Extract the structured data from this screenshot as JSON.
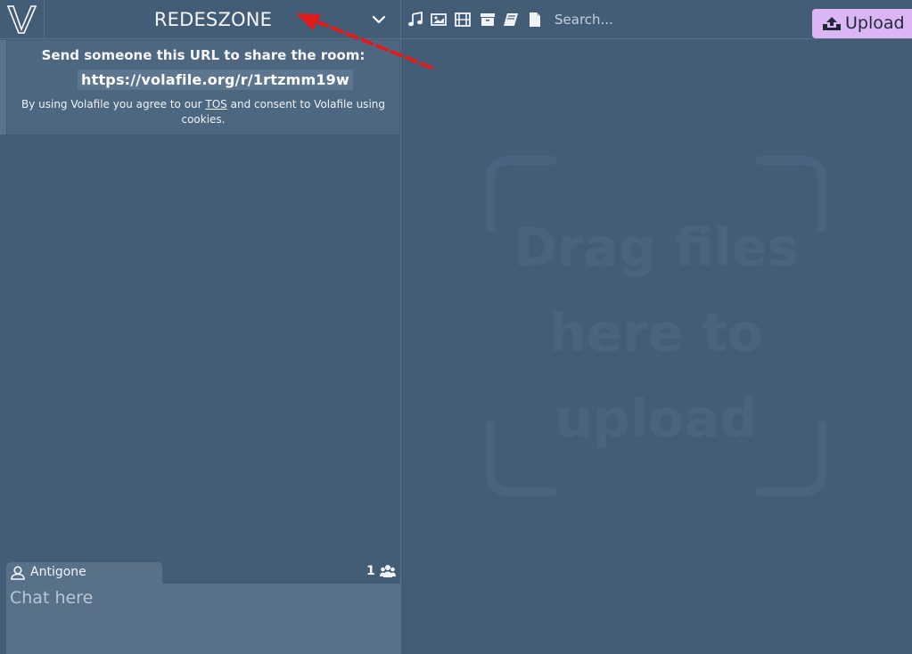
{
  "app": {
    "logo_letter": "V",
    "room_name": "REDESZONE"
  },
  "toolbar": {
    "filters": [
      {
        "name": "audio",
        "icon": "music-note-icon"
      },
      {
        "name": "image",
        "icon": "image-icon"
      },
      {
        "name": "video",
        "icon": "film-icon"
      },
      {
        "name": "archive",
        "icon": "archive-icon"
      },
      {
        "name": "document",
        "icon": "book-icon"
      },
      {
        "name": "other",
        "icon": "file-icon"
      }
    ],
    "search_placeholder": "Search...",
    "upload_label": "Upload",
    "upload_icon": "upload-tray-icon",
    "upload_color": "#dcb5f5"
  },
  "share": {
    "heading": "Send someone this URL to share the room:",
    "url": "https://volafile.org/r/1rtzmm19w",
    "tos_prefix": "By using Volafile you agree to our ",
    "tos_link": "TOS",
    "tos_suffix": " and consent to Volafile using cookies."
  },
  "dropzone": {
    "line1": "Drag files",
    "line2": "here to",
    "line3": "upload"
  },
  "chat": {
    "username": "Antigone",
    "online_count": "1",
    "placeholder": "Chat here"
  },
  "colors": {
    "background": "#445d77",
    "panel": "#587189",
    "annotation_arrow": "#e01b1b"
  }
}
